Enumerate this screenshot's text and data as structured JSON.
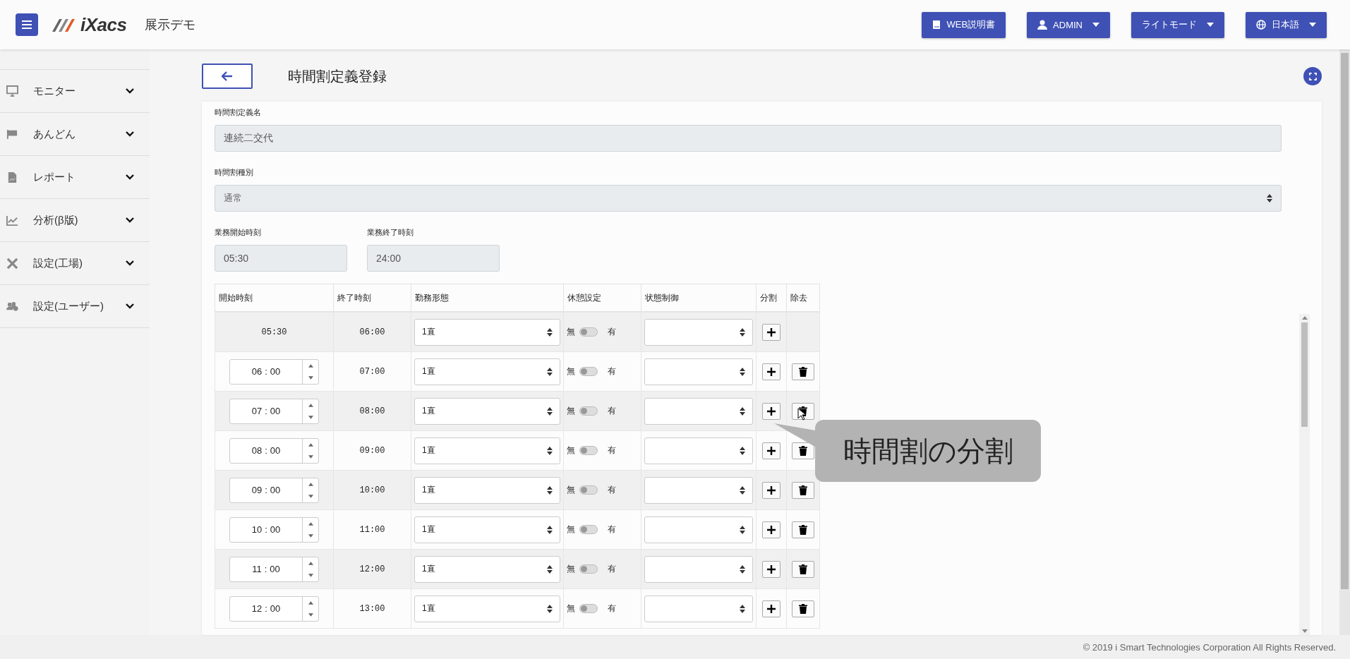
{
  "header": {
    "logo": "iXacs",
    "app_name": "展示デモ",
    "buttons": [
      {
        "label": "WEB説明書",
        "dropdown": false
      },
      {
        "label": "ADMIN",
        "dropdown": true
      },
      {
        "label": "ライトモード",
        "dropdown": true
      },
      {
        "label": "日本語",
        "dropdown": true
      }
    ]
  },
  "sidebar": {
    "items": [
      {
        "label": "モニター",
        "expanded": false
      },
      {
        "label": "あんどん",
        "expanded": false
      },
      {
        "label": "レポート",
        "expanded": false
      },
      {
        "label": "分析(β版)",
        "expanded": false
      },
      {
        "label": "設定(工場)",
        "expanded": false
      },
      {
        "label": "設定(ユーザー)",
        "expanded": false
      }
    ]
  },
  "page": {
    "title": "時間割定義登録",
    "name_field": {
      "label": "時間割定義名",
      "value": "連続二交代"
    },
    "type_field": {
      "label": "時間割種別",
      "value": "通常"
    },
    "start_field": {
      "label": "業務開始時刻",
      "value": "05:30"
    },
    "end_field": {
      "label": "業務終了時刻",
      "value": "24:00"
    },
    "table": {
      "columns": [
        "開始時刻",
        "終了時刻",
        "勤務形態",
        "休憩設定",
        "状態制御",
        "分割",
        "除去"
      ],
      "rows": [
        {
          "kind": "fixed",
          "start": "05:30",
          "end": "06:00",
          "shift": "1直",
          "break_off_label": "無",
          "break_on_label": "有",
          "break_on": false,
          "removable": false
        },
        {
          "kind": "editable",
          "start_hour": "06",
          "separator": ":",
          "start_minute": "00",
          "end": "07:00",
          "shift": "1直",
          "break_off_label": "無",
          "break_on_label": "有",
          "break_on": false,
          "removable": true
        },
        {
          "kind": "editable",
          "start_hour": "07",
          "separator": ":",
          "start_minute": "00",
          "end": "08:00",
          "shift": "1直",
          "break_off_label": "無",
          "break_on_label": "有",
          "break_on": false,
          "removable": true
        },
        {
          "kind": "editable",
          "start_hour": "08",
          "separator": ":",
          "start_minute": "00",
          "end": "09:00",
          "shift": "1直",
          "break_off_label": "無",
          "break_on_label": "有",
          "break_on": false,
          "removable": true
        },
        {
          "kind": "editable",
          "start_hour": "09",
          "separator": ":",
          "start_minute": "00",
          "end": "10:00",
          "shift": "1直",
          "break_off_label": "無",
          "break_on_label": "有",
          "break_on": false,
          "removable": true
        },
        {
          "kind": "editable",
          "start_hour": "10",
          "separator": ":",
          "start_minute": "00",
          "end": "11:00",
          "shift": "1直",
          "break_off_label": "無",
          "break_on_label": "有",
          "break_on": false,
          "removable": true
        },
        {
          "kind": "editable",
          "start_hour": "11",
          "separator": ":",
          "start_minute": "00",
          "end": "12:00",
          "shift": "1直",
          "break_off_label": "無",
          "break_on_label": "有",
          "break_on": false,
          "removable": true
        },
        {
          "kind": "editable",
          "start_hour": "12",
          "separator": ":",
          "start_minute": "00",
          "end": "13:00",
          "shift": "1直",
          "break_off_label": "無",
          "break_on_label": "有",
          "break_on": false,
          "removable": true
        }
      ]
    }
  },
  "callout": {
    "text": "時間割の分割"
  },
  "footer": {
    "copyright": "© 2019 i Smart Technologies Corporation All Rights Reserved."
  }
}
